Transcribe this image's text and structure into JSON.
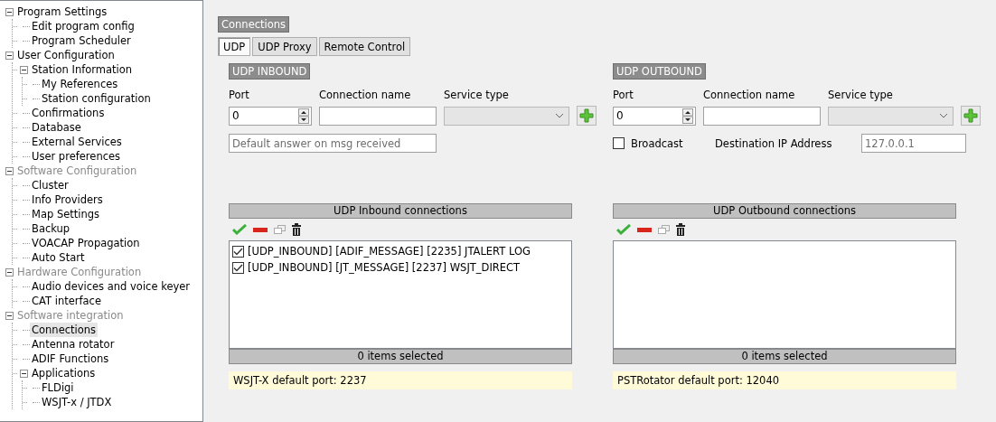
{
  "tree": [
    {
      "label": "Program Settings",
      "disabled": false,
      "selected": false,
      "expanded": true,
      "children": [
        {
          "label": "Edit program config",
          "disabled": false,
          "selected": false
        },
        {
          "label": "Program Scheduler",
          "disabled": false,
          "selected": false
        }
      ]
    },
    {
      "label": "User Configuration",
      "disabled": false,
      "selected": false,
      "expanded": true,
      "children": [
        {
          "label": "Station Information",
          "disabled": false,
          "selected": false,
          "expanded": true,
          "children": [
            {
              "label": "My References",
              "disabled": false,
              "selected": false
            },
            {
              "label": "Station configuration",
              "disabled": false,
              "selected": false
            }
          ]
        },
        {
          "label": "Confirmations",
          "disabled": false,
          "selected": false
        },
        {
          "label": "Database",
          "disabled": false,
          "selected": false
        },
        {
          "label": "External Services",
          "disabled": false,
          "selected": false
        },
        {
          "label": "User preferences",
          "disabled": false,
          "selected": false
        }
      ]
    },
    {
      "label": "Software Configuration",
      "disabled": true,
      "selected": false,
      "expanded": true,
      "children": [
        {
          "label": "Cluster",
          "disabled": false,
          "selected": false
        },
        {
          "label": "Info Providers",
          "disabled": false,
          "selected": false
        },
        {
          "label": "Map Settings",
          "disabled": false,
          "selected": false
        },
        {
          "label": "Backup",
          "disabled": false,
          "selected": false
        },
        {
          "label": "VOACAP Propagation",
          "disabled": false,
          "selected": false
        },
        {
          "label": "Auto Start",
          "disabled": false,
          "selected": false
        }
      ]
    },
    {
      "label": "Hardware Configuration",
      "disabled": true,
      "selected": false,
      "expanded": true,
      "children": [
        {
          "label": "Audio devices and voice keyer",
          "disabled": false,
          "selected": false
        },
        {
          "label": "CAT interface",
          "disabled": false,
          "selected": false
        }
      ]
    },
    {
      "label": "Software integration",
      "disabled": true,
      "selected": false,
      "expanded": true,
      "children": [
        {
          "label": "Connections",
          "disabled": false,
          "selected": true
        },
        {
          "label": "Antenna rotator",
          "disabled": false,
          "selected": false
        },
        {
          "label": "ADIF Functions",
          "disabled": false,
          "selected": false
        },
        {
          "label": "Applications",
          "disabled": false,
          "selected": false,
          "expanded": true,
          "children": [
            {
              "label": "FLDigi",
              "disabled": false,
              "selected": false
            },
            {
              "label": "WSJT-x / JTDX",
              "disabled": false,
              "selected": false
            }
          ]
        }
      ]
    }
  ],
  "panel": {
    "title": "Connections",
    "tabs": [
      {
        "label": "UDP",
        "selected": true
      },
      {
        "label": "UDP Proxy",
        "selected": false
      },
      {
        "label": "Remote Control",
        "selected": false
      }
    ],
    "inbound": {
      "header": "UDP INBOUND",
      "port_label": "Port",
      "port": "0",
      "name_label": "Connection name",
      "service_label": "Service type",
      "answer_placeholder": "Default answer on msg received",
      "list_header": "UDP Inbound connections",
      "items": [
        {
          "label": "[UDP_INBOUND] [ADIF_MESSAGE] [2235] JTALERT LOG",
          "checked": true
        },
        {
          "label": "[UDP_INBOUND] [JT_MESSAGE] [2237] WSJT_DIRECT",
          "checked": true
        }
      ],
      "footer": "0 items selected",
      "note": "WSJT-X default port: 2237"
    },
    "outbound": {
      "header": "UDP OUTBOUND",
      "port_label": "Port",
      "port": "0",
      "name_label": "Connection name",
      "service_label": "Service type",
      "broadcast": {
        "label": "Broadcast",
        "checked": false
      },
      "dest_label": "Destination IP Address",
      "dest": "127.0.0.1",
      "list_header": "UDP Outbound connections",
      "footer": "0 items selected",
      "note": "PSTRotator default port: 12040"
    }
  }
}
